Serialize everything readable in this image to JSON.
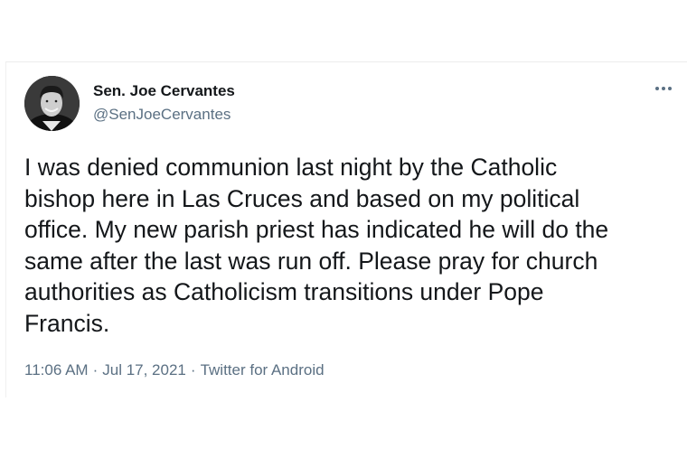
{
  "tweet": {
    "author": {
      "display_name": "Sen. Joe Cervantes",
      "handle": "@SenJoeCervantes",
      "avatar_icon": "profile-photo"
    },
    "more_icon": "more-horizontal-icon",
    "text": "I was denied communion last night by the Catholic\nbishop here in Las Cruces and based on my political\noffice. My new parish priest has indicated he will do the\nsame after the last was run off. Please pray for church\nauthorities as Catholicism transitions under Pope\nFrancis.",
    "time": "11:06 AM",
    "date": "Jul 17, 2021",
    "separator": "·",
    "source": "Twitter for Android"
  },
  "colors": {
    "text_primary": "#14171a",
    "text_secondary": "#5b7083",
    "background": "#ffffff"
  }
}
